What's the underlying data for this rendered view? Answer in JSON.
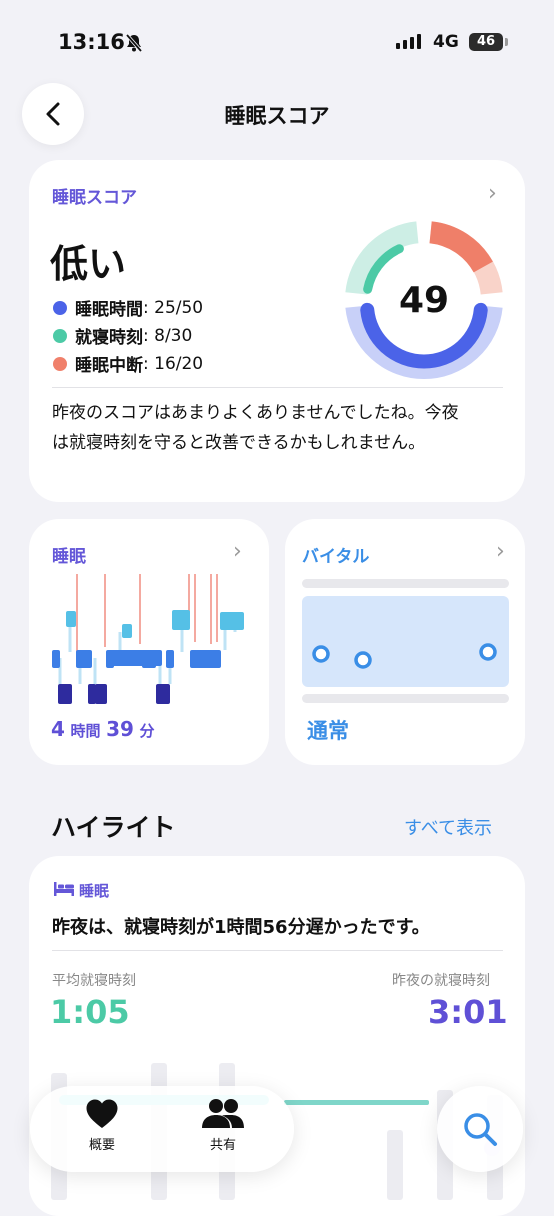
{
  "status_bar": {
    "time": "13:16",
    "network": "4G",
    "battery": "46"
  },
  "header": {
    "title": "睡眠スコア"
  },
  "score_card": {
    "label": "睡眠スコア",
    "level": "低い",
    "score": "49",
    "metrics": [
      {
        "name": "睡眠時間",
        "value": ": 25/50",
        "color": "#4b63e8"
      },
      {
        "name": "就寝時刻",
        "value": ": 8/30",
        "color": "#4ccaa6"
      },
      {
        "name": "睡眠中断",
        "value": ": 16/20",
        "color": "#f0806b"
      }
    ],
    "summary": "昨夜のスコアはあまりよくありませんでしたね。今夜は就寝時刻を守ると改善できるかもしれません。"
  },
  "sleep_card": {
    "title": "睡眠",
    "hours": "4",
    "hours_unit": "時間",
    "minutes": "39",
    "minutes_unit": "分"
  },
  "vital_card": {
    "title": "バイタル",
    "status": "通常"
  },
  "highlights": {
    "title": "ハイライト",
    "see_all": "すべて表示",
    "tag": "睡眠",
    "text": "昨夜は、就寝時刻が1時間56分遅かったです。",
    "avg_label": "平均就寝時刻",
    "avg_value": "1:05",
    "last_label": "昨夜の就寝時刻",
    "last_value": "3:01"
  },
  "tabbar": {
    "summary": "概要",
    "sharing": "共有"
  }
}
